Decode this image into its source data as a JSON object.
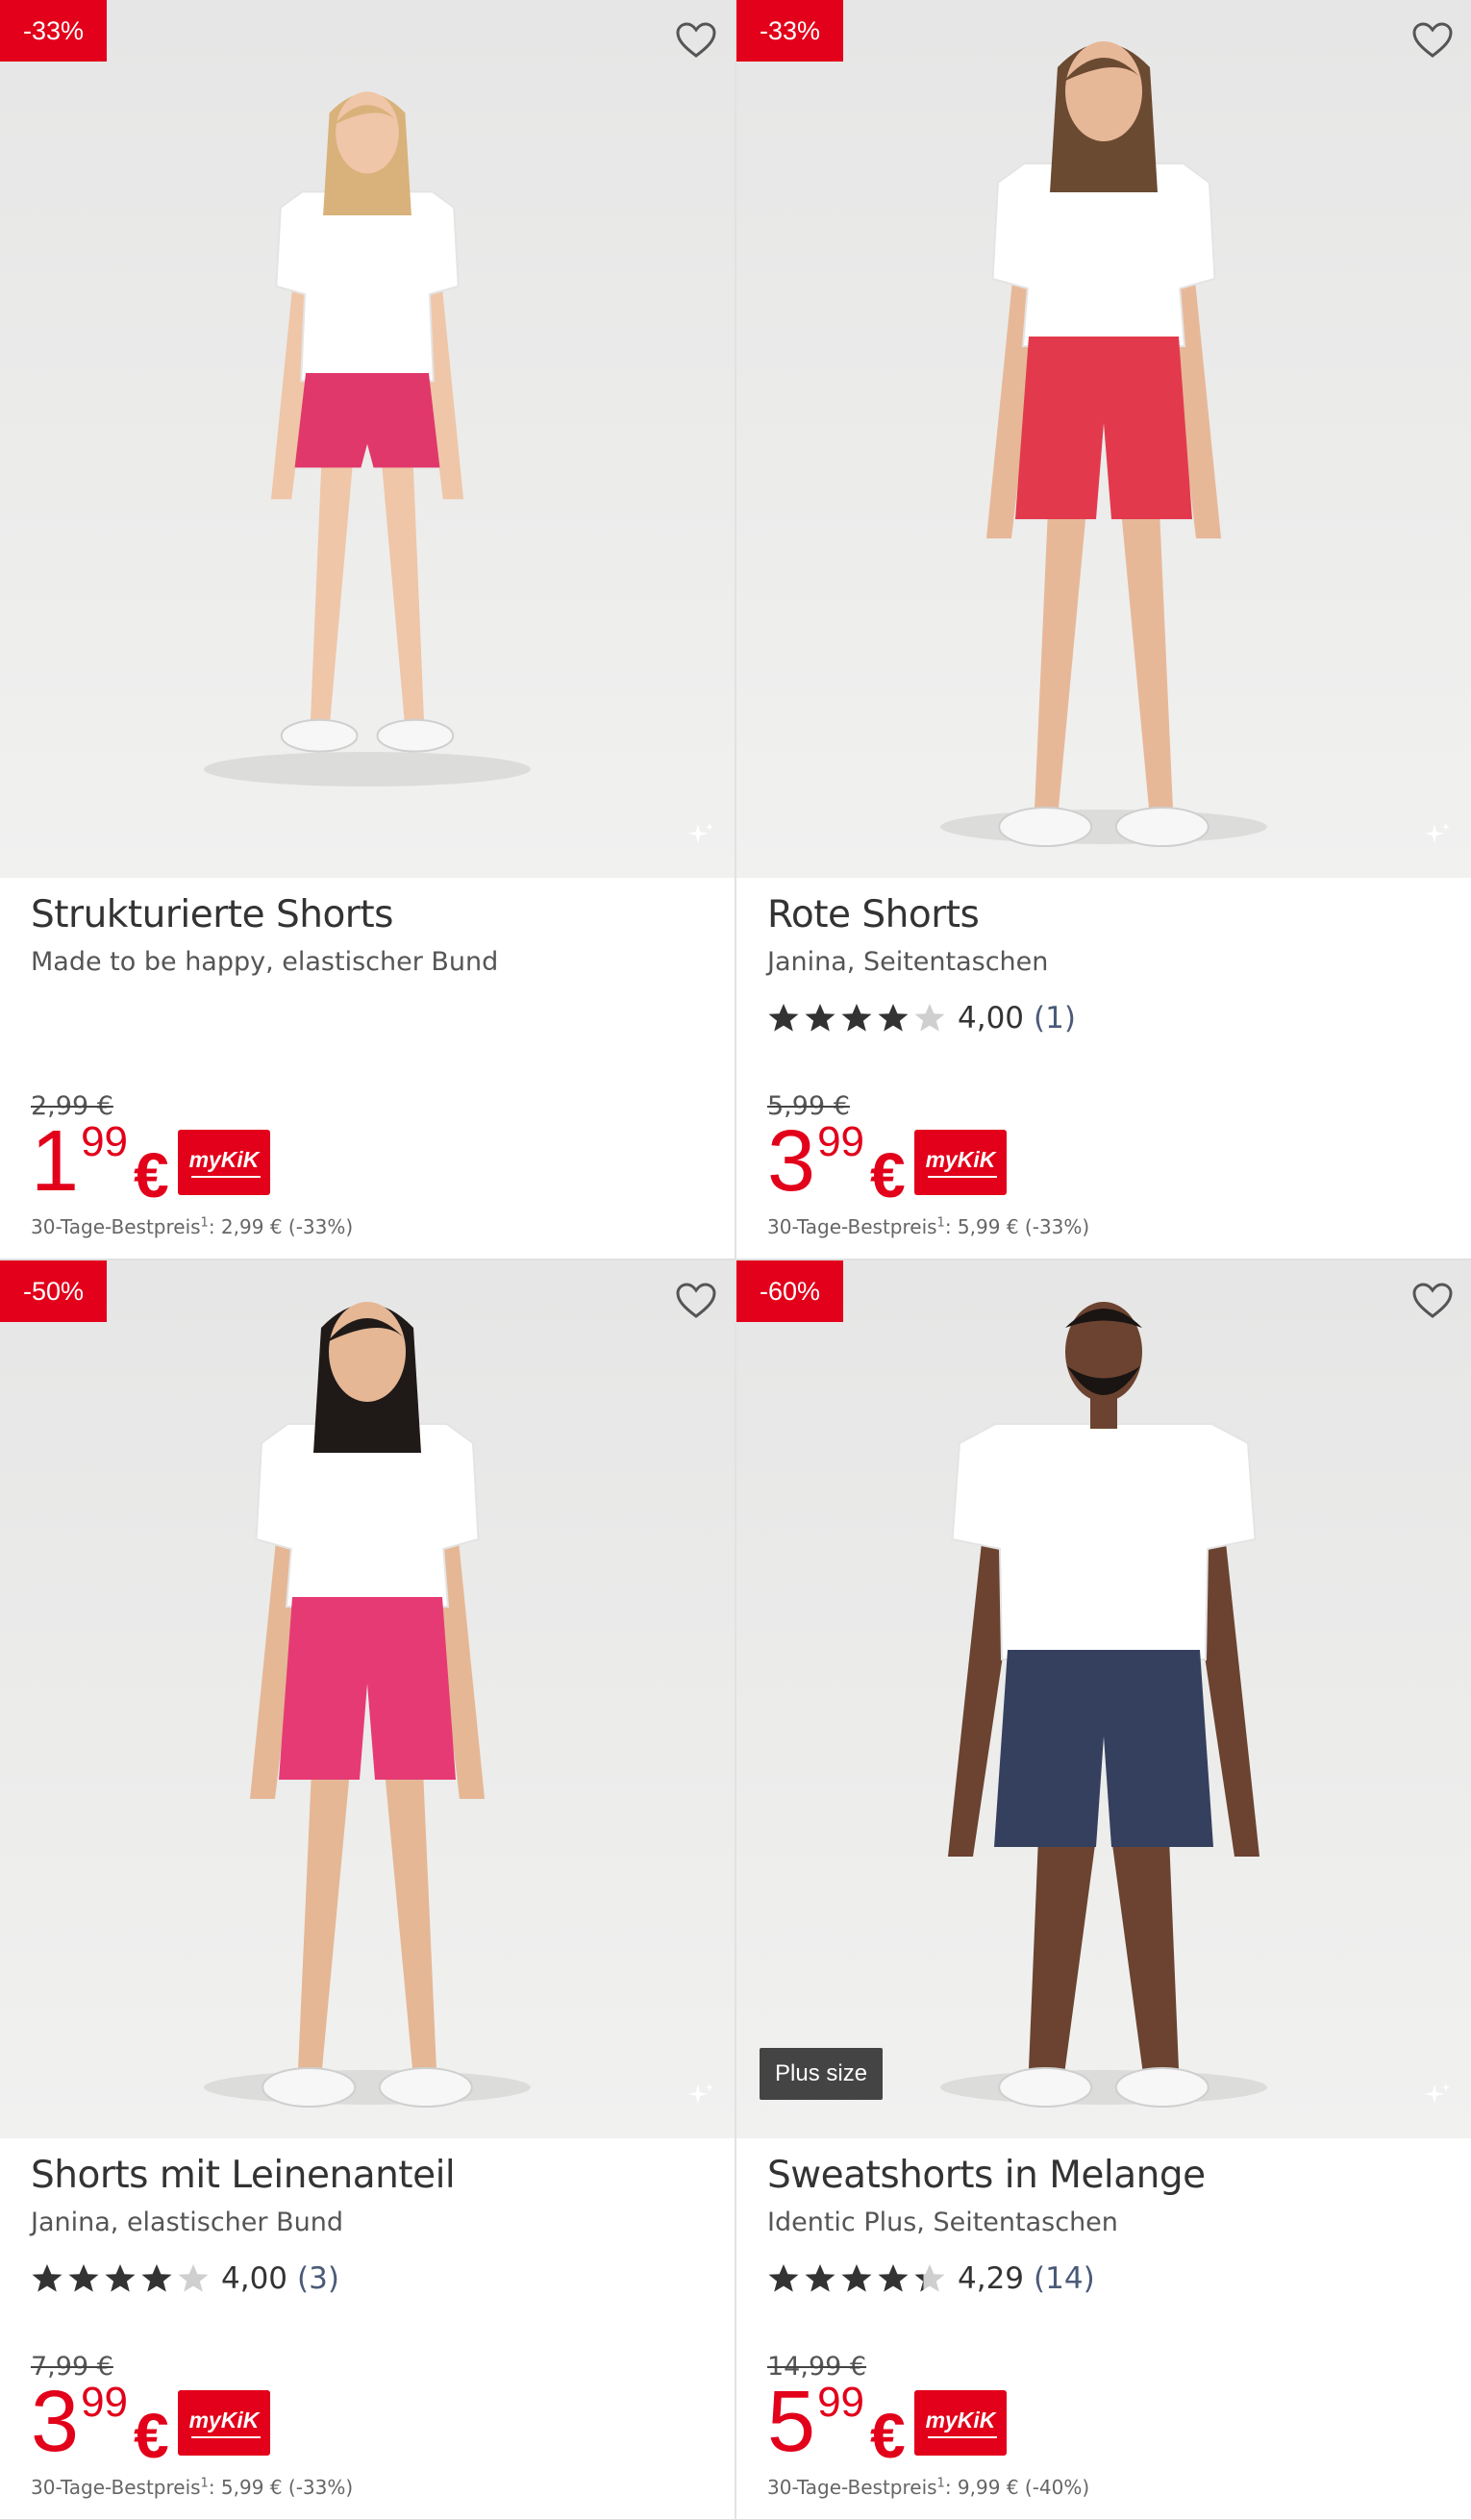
{
  "products": [
    {
      "discount": "-33%",
      "title": "Strukturierte Shorts",
      "subtitle": "Made to be happy, elastischer Bund",
      "has_rating": false,
      "old_price": "2,99 €",
      "price_int": "1",
      "price_cents": "99",
      "currency": "€",
      "loyalty_badge": "myKiK",
      "ref_label": "30-Tage-Bestpreis",
      "ref_sup": "1",
      "ref_value": ": 2,99 € (-33%)",
      "plus_label": "",
      "figure": {
        "hair": "#d8b27a",
        "skin": "#efc6a8",
        "top": "#ffffff",
        "shorts": "#e0386a",
        "kind": "child"
      }
    },
    {
      "discount": "-33%",
      "title": "Rote Shorts",
      "subtitle": "Janina, Seitentaschen",
      "has_rating": true,
      "stars": 4.0,
      "rating_value": "4,00",
      "rating_count": "(1)",
      "old_price": "5,99 €",
      "price_int": "3",
      "price_cents": "99",
      "currency": "€",
      "loyalty_badge": "myKiK",
      "ref_label": "30-Tage-Bestpreis",
      "ref_sup": "1",
      "ref_value": ": 5,99 € (-33%)",
      "plus_label": "",
      "figure": {
        "hair": "#6b4a32",
        "skin": "#e7b898",
        "top": "#ffffff",
        "shorts": "#e23a4c",
        "kind": "woman"
      }
    },
    {
      "discount": "-50%",
      "title": "Shorts mit Leinenanteil",
      "subtitle": "Janina, elastischer Bund",
      "has_rating": true,
      "stars": 4.0,
      "rating_value": "4,00",
      "rating_count": "(3)",
      "old_price": "7,99 €",
      "price_int": "3",
      "price_cents": "99",
      "currency": "€",
      "loyalty_badge": "myKiK",
      "ref_label": "30-Tage-Bestpreis",
      "ref_sup": "1",
      "ref_value": ": 5,99 € (-33%)",
      "plus_label": "",
      "figure": {
        "hair": "#1f1a18",
        "skin": "#e5b795",
        "top": "#ffffff",
        "shorts": "#e63a75",
        "kind": "woman"
      }
    },
    {
      "discount": "-60%",
      "title": "Sweatshorts in Melange",
      "subtitle": "Identic Plus, Seitentaschen",
      "has_rating": true,
      "stars": 4.29,
      "rating_value": "4,29",
      "rating_count": "(14)",
      "old_price": "14,99 €",
      "price_int": "5",
      "price_cents": "99",
      "currency": "€",
      "loyalty_badge": "myKiK",
      "ref_label": "30-Tage-Bestpreis",
      "ref_sup": "1",
      "ref_value": ": 9,99 € (-40%)",
      "plus_label": "Plus size",
      "figure": {
        "hair": "#1a1412",
        "skin": "#6b4330",
        "top": "#ffffff",
        "shorts": "#34405e",
        "kind": "man"
      }
    }
  ]
}
